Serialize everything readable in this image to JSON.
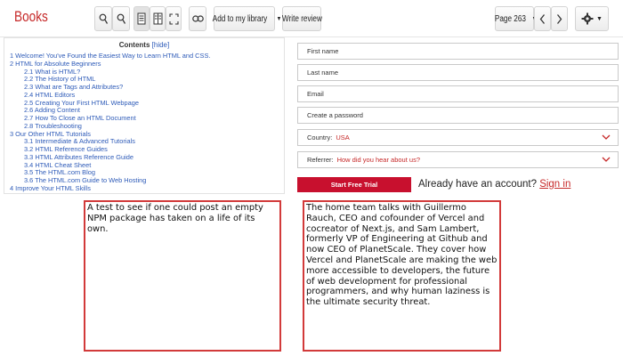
{
  "toolbar": {
    "brand": "Books",
    "add_library_label": "Add to my library",
    "write_review_label": "Write review",
    "page_label": "Page 263"
  },
  "toc": {
    "title": "Contents",
    "hide_label": "[hide]",
    "items": [
      {
        "level": 1,
        "text": "1 Welcome! You've Found the Easiest Way to Learn HTML and CSS."
      },
      {
        "level": 1,
        "text": "2 HTML for Absolute Beginners"
      },
      {
        "level": 2,
        "text": "2.1 What is HTML?"
      },
      {
        "level": 2,
        "text": "2.2 The History of HTML"
      },
      {
        "level": 2,
        "text": "2.3 What are Tags and Attributes?"
      },
      {
        "level": 2,
        "text": "2.4 HTML Editors"
      },
      {
        "level": 2,
        "text": "2.5 Creating Your First HTML Webpage"
      },
      {
        "level": 2,
        "text": "2.6 Adding Content"
      },
      {
        "level": 2,
        "text": "2.7 How To Close an HTML Document"
      },
      {
        "level": 2,
        "text": "2.8 Troubleshooting"
      },
      {
        "level": 1,
        "text": "3 Our Other HTML Tutorials"
      },
      {
        "level": 2,
        "text": "3.1 Intermediate & Advanced Tutorials"
      },
      {
        "level": 2,
        "text": "3.2 HTML Reference Guides"
      },
      {
        "level": 2,
        "text": "3.3 HTML Attributes Reference Guide"
      },
      {
        "level": 2,
        "text": "3.4 HTML Cheat Sheet"
      },
      {
        "level": 2,
        "text": "3.5 The HTML.com Blog"
      },
      {
        "level": 2,
        "text": "3.6 The HTML.com Guide to Web Hosting"
      },
      {
        "level": 1,
        "text": "4 Improve Your HTML Skills"
      }
    ]
  },
  "form": {
    "first_name_placeholder": "First name",
    "last_name_placeholder": "Last name",
    "email_placeholder": "Email",
    "password_placeholder": "Create a password",
    "country_label": "Country:",
    "country_value": "USA",
    "referrer_label": "Referrer:",
    "referrer_value": "How did you hear about us?",
    "submit_label": "Start Free Trial",
    "account_prompt": "Already have an account?",
    "signin_label": "Sign in"
  },
  "textboxes": {
    "left": "A test to see if one could post an empty NPM package has taken on a life of its own.",
    "right": "The home team talks with Guillermo Rauch, CEO and cofounder of Vercel and cocreator of Next.js, and Sam Lambert, formerly VP of Engineering at Github and now CEO of PlanetScale. They cover how Vercel and PlanetScale are making the web more accessible to developers, the future of web development for professional programmers, and why human laziness is the ultimate security threat."
  },
  "colors": {
    "accent": "#c8102e",
    "link": "#2e5bb8",
    "box_border": "#d23a3a"
  }
}
